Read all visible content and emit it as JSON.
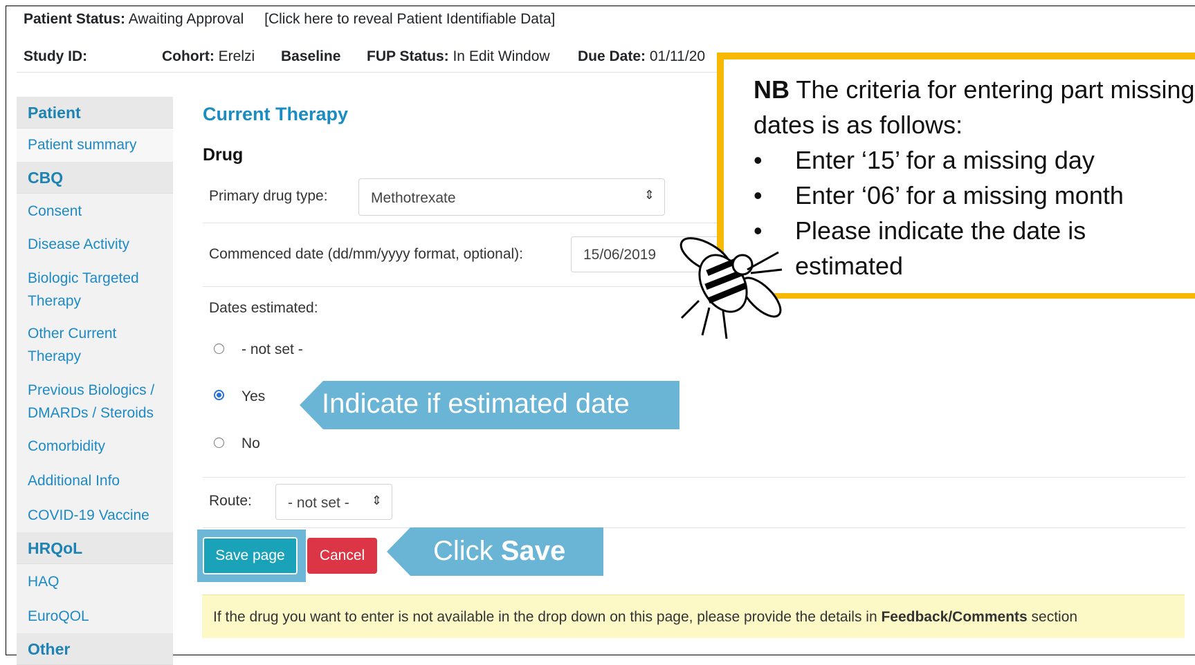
{
  "header": {
    "patient_status_label": "Patient Status:",
    "patient_status_value": " Awaiting Approval",
    "reveal_link": "[Click here to reveal Patient Identifiable Data]"
  },
  "study": {
    "study_id_label": "Study ID:",
    "cohort_label": "Cohort:",
    "cohort_value": " Erelzi",
    "baseline": "Baseline",
    "fup_label": "FUP Status:",
    "fup_value": " In Edit Window",
    "due_label": "Due Date:",
    "due_value": " 01/11/20"
  },
  "sidebar": {
    "patient_header": "Patient",
    "patient_summary": "Patient summary",
    "cbq_header": "CBQ",
    "consent": "Consent",
    "disease_activity": "Disease Activity",
    "biologic_targeted_therapy": "Biologic Targeted Therapy",
    "other_current_therapy": "Other Current Therapy",
    "previous_biologics": "Previous Biologics / DMARDs / Steroids",
    "comorbidity": "Comorbidity",
    "additional_info": "Additional Info",
    "covid_vaccine": "COVID-19 Vaccine",
    "hrqol_header": "HRQoL",
    "haq": "HAQ",
    "euroqol": "EuroQOL",
    "other_header": "Other"
  },
  "form": {
    "page_title": "Current Therapy",
    "section_title": "Drug",
    "primary_drug_label": "Primary drug type:",
    "primary_drug_value": "Methotrexate",
    "commenced_label": "Commenced date (dd/mm/yyyy format, optional):",
    "commenced_value": "15/06/2019",
    "dates_estimated_label": "Dates estimated:",
    "option_not_set": "- not set -",
    "option_yes": "Yes",
    "option_no": "No",
    "route_label": "Route:",
    "route_value": "- not set -",
    "save_button": "Save page",
    "cancel_button": "Cancel"
  },
  "info_bar": {
    "text_before": "If the drug you want to enter is not available in the drop down on this page, please provide the details in ",
    "bold": "Feedback/Comments",
    "text_after": " section"
  },
  "annotations": {
    "estimated_callout": "Indicate if estimated date",
    "save_callout_prefix": "Click ",
    "save_callout_bold": "Save",
    "note_bold": "NB",
    "note_text": " The criteria for entering part missing dates is as follows:",
    "note_items": [
      "Enter ‘15’ for a missing day",
      "Enter ‘06’ for a missing month",
      "Please indicate the date is estimated"
    ]
  },
  "colors": {
    "accent": "#1a8cc1",
    "save": "#1aa2b8",
    "cancel": "#dc3545",
    "callout": "#6ab4d6",
    "note_border": "#f6b800",
    "info_bar": "#fcf9c7"
  },
  "icons": [
    "select-arrow-icon",
    "bee-icon",
    "radio-icon"
  ]
}
